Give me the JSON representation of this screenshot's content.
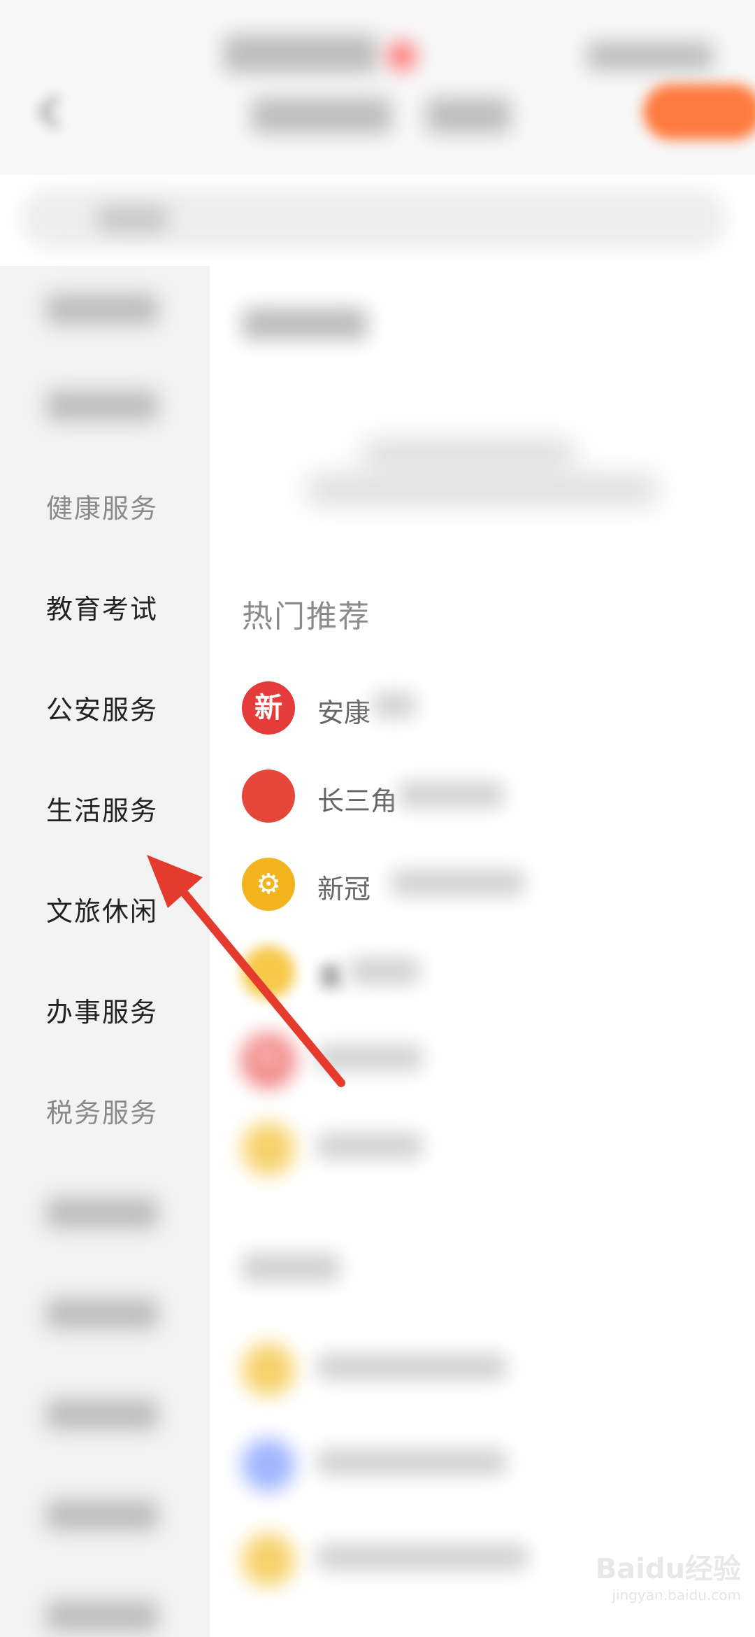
{
  "sidebar": {
    "items": [
      {
        "label": "健康服务"
      },
      {
        "label": "教育考试"
      },
      {
        "label": "公安服务"
      },
      {
        "label": "生活服务"
      },
      {
        "label": "文旅休闲"
      },
      {
        "label": "办事服务"
      },
      {
        "label": "税务服务"
      }
    ]
  },
  "main": {
    "hot_title": "热门推荐",
    "services": [
      {
        "icon_char": "新",
        "text": "安康"
      },
      {
        "icon_char": "",
        "text": "长三角"
      },
      {
        "icon_char": "",
        "text": "新冠"
      },
      {
        "icon_char": "",
        "text": "重"
      },
      {
        "icon_char": "快",
        "text": ""
      }
    ]
  },
  "colors": {
    "accent": "#ff7a3d",
    "arrow": "#e53b2f"
  },
  "watermark": {
    "text": "Baidu经验",
    "sub": "jingyan.baidu.com"
  }
}
